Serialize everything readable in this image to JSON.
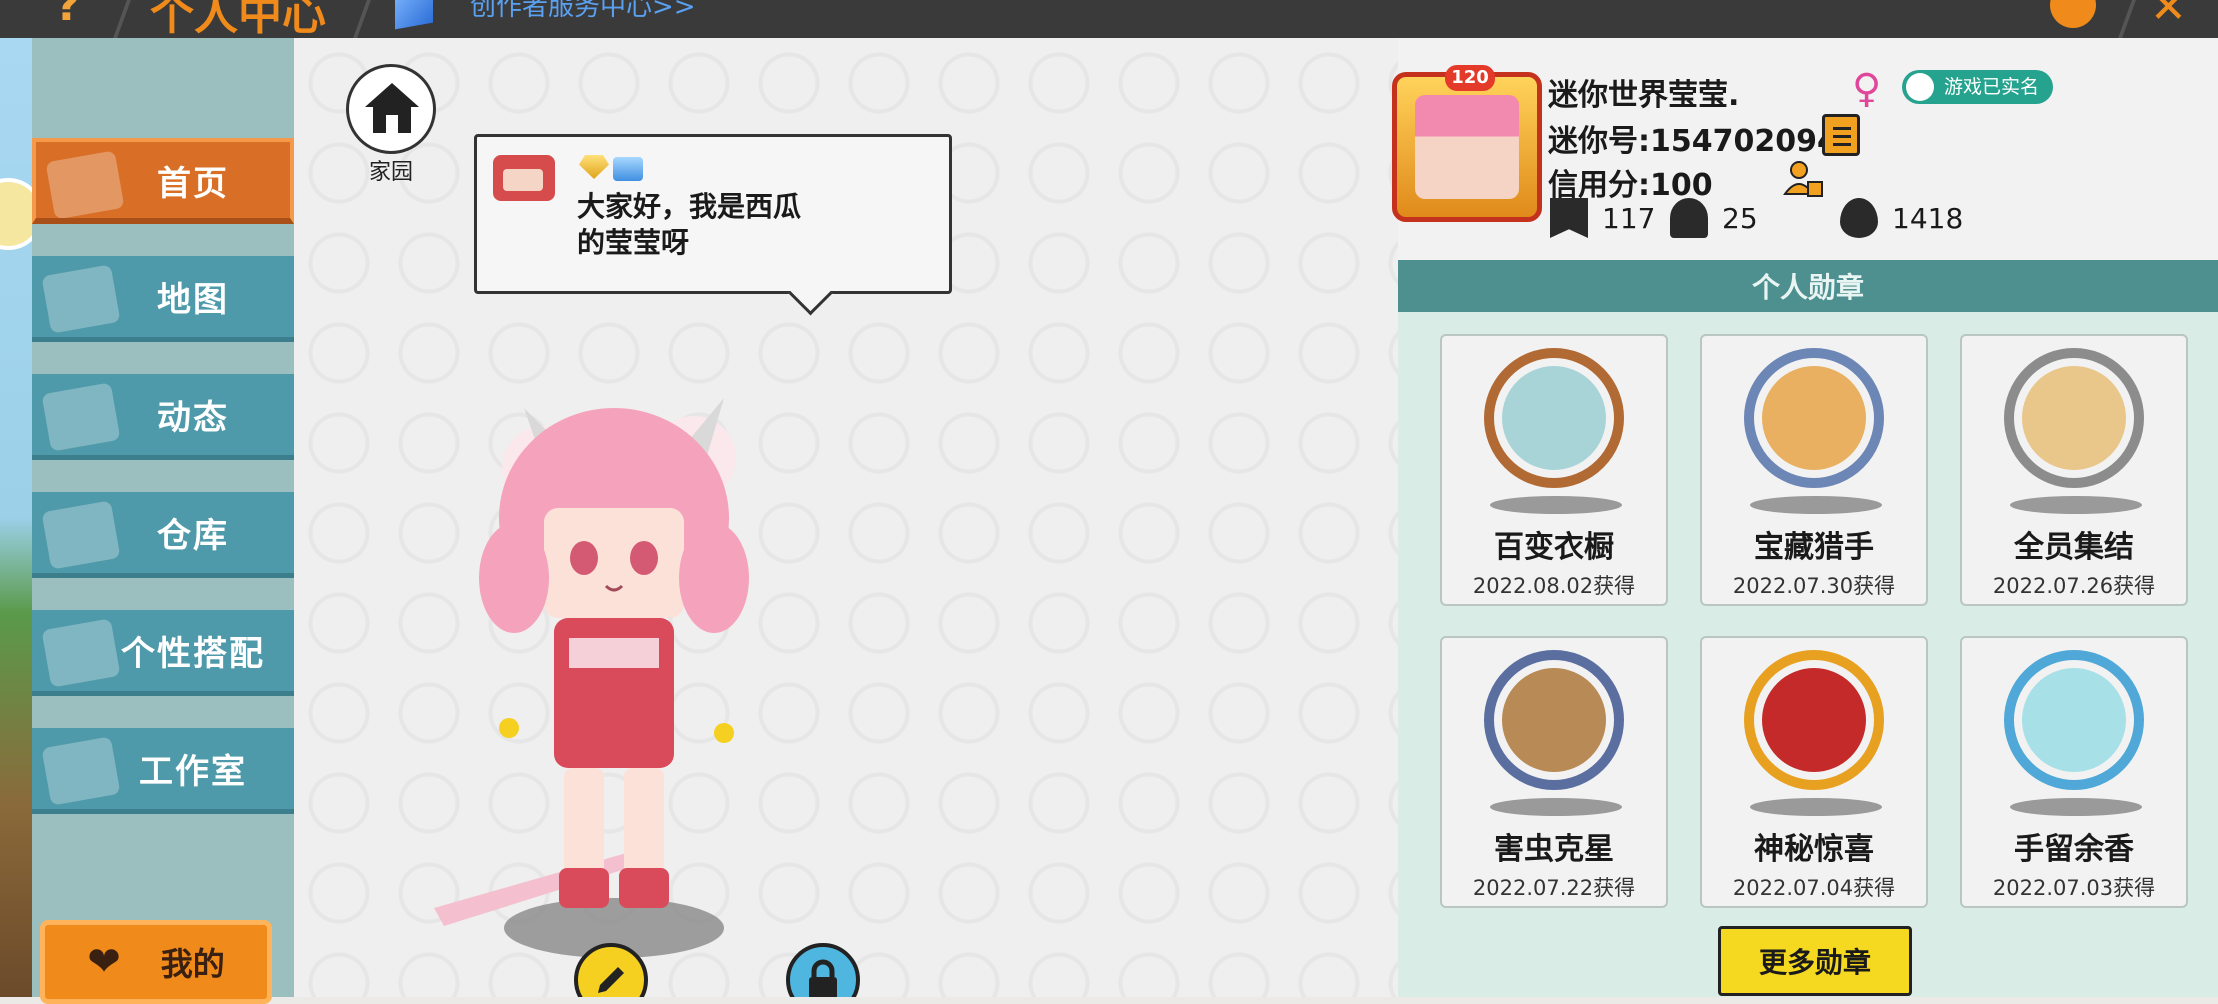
{
  "topbar": {
    "title": "个人中心",
    "service_link": "创作者服务中心>>"
  },
  "sidebar": {
    "items": [
      {
        "label": "首页",
        "active": true,
        "icon": "home-icon"
      },
      {
        "label": "地图",
        "active": false,
        "icon": "map-icon"
      },
      {
        "label": "动态",
        "active": false,
        "icon": "bell-icon"
      },
      {
        "label": "仓库",
        "active": false,
        "icon": "warehouse-icon"
      },
      {
        "label": "个性搭配",
        "active": false,
        "icon": "outfit-icon"
      },
      {
        "label": "工作室",
        "active": false,
        "icon": "studio-icon"
      }
    ],
    "mine_label": "我的"
  },
  "center": {
    "home_label": "家园",
    "bubble_text": "大家好，我是西瓜的莹莹呀"
  },
  "profile": {
    "level": "120",
    "name": "迷你世界莹莹.",
    "gender_icon": "♀",
    "realname_badge": "游戏已实名",
    "mini_id": "迷你号:1547020946",
    "credit": "信用分:100",
    "stats": {
      "favorites": "117",
      "fans": "25",
      "heat": "1418"
    }
  },
  "badges": {
    "header": "个人勋章",
    "items": [
      {
        "name": "百变衣橱",
        "date": "2022.08.02获得",
        "ring": "#b26a35",
        "fill": "#a8d4d8"
      },
      {
        "name": "宝藏猎手",
        "date": "2022.07.30获得",
        "ring": "#6c86b5",
        "fill": "#e8b060"
      },
      {
        "name": "全员集结",
        "date": "2022.07.26获得",
        "ring": "#8c8c8c",
        "fill": "#e9c68a"
      },
      {
        "name": "害虫克星",
        "date": "2022.07.22获得",
        "ring": "#5a6fa0",
        "fill": "#b88a55"
      },
      {
        "name": "神秘惊喜",
        "date": "2022.07.04获得",
        "ring": "#e8a020",
        "fill": "#c42a2a"
      },
      {
        "name": "手留余香",
        "date": "2022.07.03获得",
        "ring": "#4fa8d8",
        "fill": "#a8e0e8"
      }
    ],
    "more_label": "更多勋章"
  },
  "colors": {
    "accent_orange": "#f08a1a",
    "nav_teal": "#4f9aaa",
    "badge_header": "#4e8f8f",
    "realname_green": "#26a38e"
  }
}
